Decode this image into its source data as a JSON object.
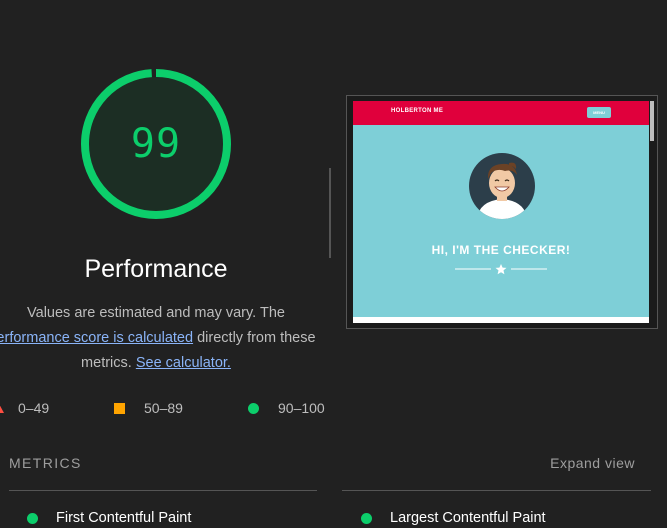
{
  "gauge": {
    "score": "99",
    "score_fraction": 0.99,
    "color": "#0cce6b"
  },
  "category": {
    "title": "Performance"
  },
  "description": {
    "line1": "Values are estimated and may vary. The",
    "link1": "erformance score is calculated",
    "line2_suffix": " directly from these",
    "line3_prefix": "metrics. ",
    "link2": "See calculator."
  },
  "legend": {
    "items": [
      {
        "label": "0–49",
        "shape": "triangle-icon",
        "color": "#ff4e42"
      },
      {
        "label": "50–89",
        "shape": "square-icon",
        "color": "#ffa400"
      },
      {
        "label": "90–100",
        "shape": "circle-icon",
        "color": "#0cce6b"
      }
    ]
  },
  "screenshot": {
    "brand": "HOLBERTON ME",
    "menu_button": "MENU",
    "heading": "HI, I'M THE CHECKER!",
    "nav_color": "#e0003c",
    "bg_color": "#7ecfd7"
  },
  "metrics": {
    "header": "METRICS",
    "expand_label": "Expand view",
    "items": [
      {
        "label": "First Contentful Paint",
        "status_color": "#0cce6b"
      },
      {
        "label": "Largest Contentful Paint",
        "status_color": "#0cce6b"
      }
    ]
  }
}
